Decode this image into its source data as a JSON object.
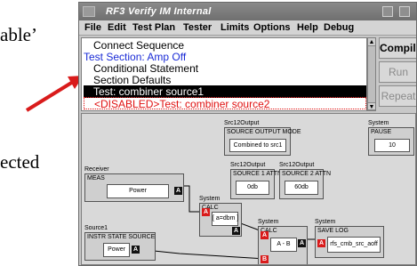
{
  "background_slide": {
    "fragment_top": "able’",
    "fragment_bottom": "ected"
  },
  "window": {
    "title": "RF3 Verify IM Internal"
  },
  "menu": [
    "File",
    "Edit",
    "Test Plan",
    "Tester",
    "Limits",
    "Options",
    "Help",
    "Debug"
  ],
  "tree": {
    "rows": [
      {
        "text": "Connect Sequence",
        "indent": true,
        "state": "normal"
      },
      {
        "text": "Test Section: Amp Off",
        "indent": false,
        "state": "section"
      },
      {
        "text": "Conditional Statement",
        "indent": true,
        "state": "normal"
      },
      {
        "text": "Section Defaults",
        "indent": true,
        "state": "normal"
      },
      {
        "text": "Test: combiner source1",
        "indent": true,
        "state": "selected"
      },
      {
        "text": "<DISABLED>Test: combiner source2",
        "indent": true,
        "state": "disabled"
      }
    ]
  },
  "side_buttons": {
    "compile": "Compile",
    "run": "Run",
    "repeat": "Repeat"
  },
  "blocks": {
    "src2_mode": {
      "owner": "Src12Output",
      "title": "SOURCE OUTPUT MODE",
      "value": "Combined to src1"
    },
    "pause": {
      "owner": "System",
      "title": "PAUSE",
      "value": "10"
    },
    "src1_attn": {
      "owner": "Src12Output",
      "title": "SOURCE 1 ATTN",
      "value": "0db"
    },
    "src2_attn": {
      "owner": "Src12Output",
      "title": "SOURCE 2 ATTN",
      "value": "60db"
    },
    "receiver": {
      "owner": "Receiver",
      "title": "MEAS",
      "value": "Power",
      "out": "A"
    },
    "calc1": {
      "owner": "System",
      "title": "CALC",
      "value": "[ a=dbm ]",
      "in": "A",
      "out": "A"
    },
    "source": {
      "owner": "Source1",
      "title": "INSTR STATE SOURCE",
      "value": "Power",
      "out": "A"
    },
    "calc2": {
      "owner": "System",
      "title": "CALC",
      "value": "A - B",
      "in_a": "A",
      "in_b": "B",
      "out": "A"
    },
    "savelog": {
      "owner": "System",
      "title": "SAVE LOG",
      "value": "rfs_cmb_src_aoff",
      "in": "A"
    }
  },
  "colors": {
    "accent_red": "#d91b1b",
    "selection": "#000000",
    "canvas": "#d9d9d9"
  }
}
